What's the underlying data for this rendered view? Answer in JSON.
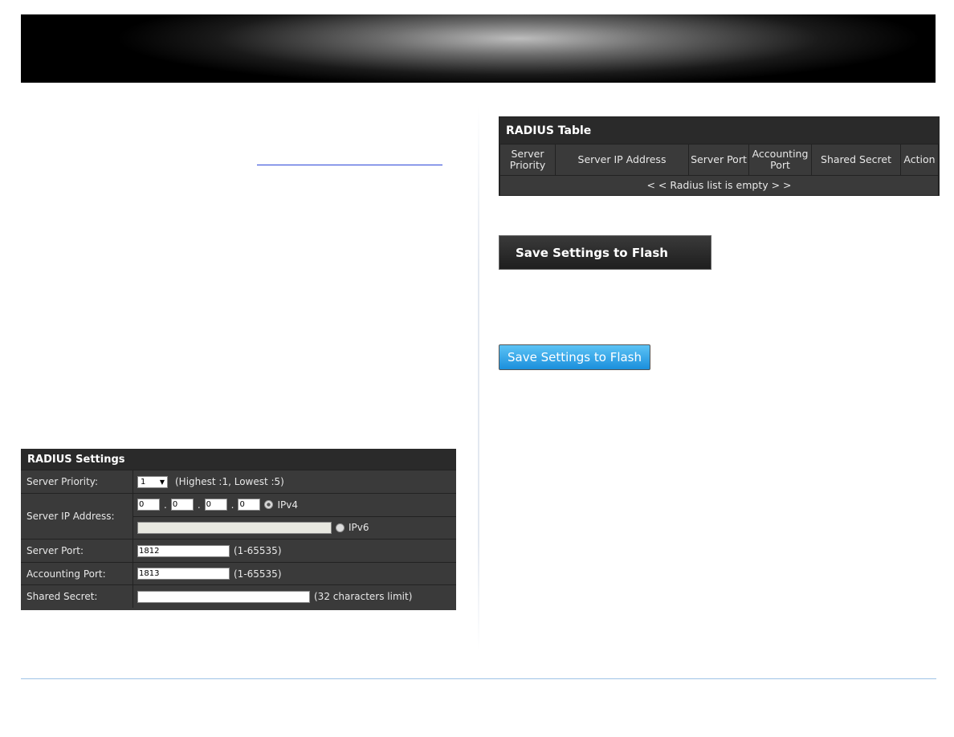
{
  "radius_settings": {
    "title": "RADIUS Settings",
    "server_priority": {
      "label": "Server Priority:",
      "value": "1",
      "hint": "(Highest :1, Lowest :5)"
    },
    "server_ip": {
      "label": "Server IP Address:",
      "octets": [
        "0",
        "0",
        "0",
        "0"
      ],
      "sep": ".",
      "ipv4": "IPv4",
      "ipv6": "IPv6",
      "ipv6_value": ""
    },
    "server_port": {
      "label": "Server Port:",
      "value": "1812",
      "hint": "(1-65535)"
    },
    "accounting_port": {
      "label": "Accounting Port:",
      "value": "1813",
      "hint": "(1-65535)"
    },
    "shared_secret": {
      "label": "Shared Secret:",
      "value": "",
      "hint": "(32 characters limit)"
    }
  },
  "radius_table": {
    "title": "RADIUS Table",
    "columns": [
      "Server Priority",
      "Server IP Address",
      "Server Port",
      "Accounting Port",
      "Shared Secret",
      "Action"
    ],
    "empty": "< < Radius list is empty > >"
  },
  "save_dark": "Save Settings to Flash",
  "save_blue": "Save Settings to Flash"
}
